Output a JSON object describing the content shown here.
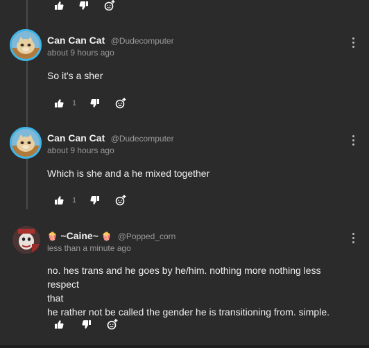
{
  "comments": [
    {
      "name": "Can Can Cat",
      "handle": "@Dudecomputer",
      "time": "about 9 hours ago",
      "body": "So it's a sher",
      "likes": "1"
    },
    {
      "name": "Can Can Cat",
      "handle": "@Dudecomputer",
      "time": "about 9 hours ago",
      "body": "Which is she and a he mixed together",
      "likes": "1"
    },
    {
      "name": "~Caine~",
      "name_decoration": "🍿",
      "handle": "@Popped_corn",
      "time": "less than a minute ago",
      "body_line1": "no. hes trans and he goes by he/him. nothing more nothing less respect",
      "body_line2": "that",
      "body_line3": "he rather not be called the gender he is transitioning from. simple."
    }
  ],
  "icons": {
    "like": "thumbs-up-icon",
    "dislike": "thumbs-down-icon",
    "react": "add-reaction-icon",
    "more": "kebab-menu-icon"
  },
  "colors": {
    "background": "#2b2b2b",
    "avatar_ring": "#3fb5e8",
    "text_muted": "#9a9a9a"
  }
}
